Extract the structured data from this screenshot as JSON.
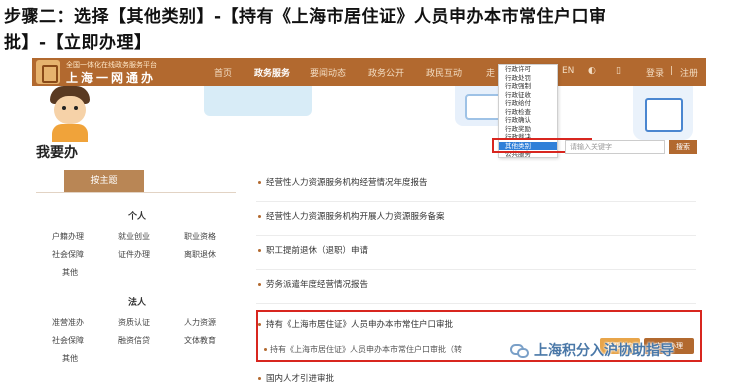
{
  "instruction": {
    "line1": "步骤二：选择【其他类别】-【持有《上海市居住证》人员申办本市常住户口审",
    "line2": "批】-【立即办理】"
  },
  "header": {
    "logo_sub": "全国一体化在线政务服务平台",
    "logo_title": "上海一网通办",
    "nav": [
      "首页",
      "政务服务",
      "要闻动态",
      "政务公开",
      "政民互动",
      "走",
      "EN"
    ],
    "icons": [
      "accessibility-icon",
      "mobile-icon"
    ],
    "login": "登录",
    "separator": "|",
    "register": "注册",
    "brand_color": "#b2692f"
  },
  "dropdown": {
    "items": [
      "行政许可",
      "行政处罚",
      "行政强制",
      "行政征收",
      "行政给付",
      "行政检查",
      "行政确认",
      "行政奖励",
      "行政裁决",
      "其他类别",
      "公共服务"
    ],
    "selected": "其他类别"
  },
  "main": {
    "page_title": "我要办",
    "search_placeholder": "请输入关键字",
    "search_button": "搜索",
    "category_tab": "按主题",
    "personal": {
      "heading": "个人",
      "links": [
        "户籍办理",
        "就业创业",
        "职业资格",
        "社会保障",
        "证件办理",
        "离职退休",
        "其他"
      ]
    },
    "corporate": {
      "heading": "法人",
      "links": [
        "准营准办",
        "资质认证",
        "人力资源",
        "社会保障",
        "融资信贷",
        "文体教育",
        "其他"
      ]
    },
    "list": [
      "经营性人力资源服务机构经营情况年度报告",
      "经营性人力资源服务机构开展人力资源服务备案",
      "职工提前退休（退职）申请",
      "劳务派遣年度经营情况报告",
      "持有《上海市居住证》人员申办本市常住户口审批",
      "国内人才引进审批"
    ],
    "sub_item": "持有《上海市居住证》人员申办本市常住户口审批（转",
    "apply_button": "我要申办",
    "apply_button2": "立即办理"
  },
  "watermark": {
    "text": "上海积分入沪协助指导"
  }
}
